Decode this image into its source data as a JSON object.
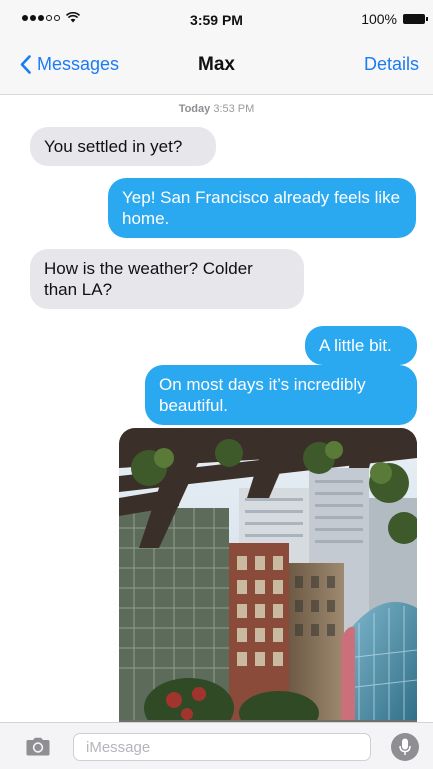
{
  "status_bar": {
    "time": "3:59 PM",
    "battery_percent": "100%",
    "signal_strength": 3,
    "signal_max": 5
  },
  "nav": {
    "back_label": "Messages",
    "title": "Max",
    "details_label": "Details"
  },
  "conversation": {
    "timestamp_day": "Today",
    "timestamp_time": "3:53 PM",
    "messages": [
      {
        "direction": "incoming",
        "text": "You settled in yet?"
      },
      {
        "direction": "outgoing",
        "text": "Yep! San Francisco already feels like home."
      },
      {
        "direction": "incoming",
        "text": "How is the weather? Colder than LA?"
      },
      {
        "direction": "outgoing",
        "text": "A little bit."
      },
      {
        "direction": "outgoing",
        "text": "On most days it’s incredibly beautiful."
      }
    ]
  },
  "input": {
    "placeholder": "iMessage"
  },
  "colors": {
    "accent": "#1a7cf5",
    "outgoing_bubble": "#2aa8f0",
    "incoming_bubble": "#e6e6eb"
  },
  "icons": {
    "back": "chevron-left-icon",
    "camera": "camera-icon",
    "mic": "microphone-icon",
    "wifi": "wifi-icon",
    "battery": "battery-icon"
  }
}
